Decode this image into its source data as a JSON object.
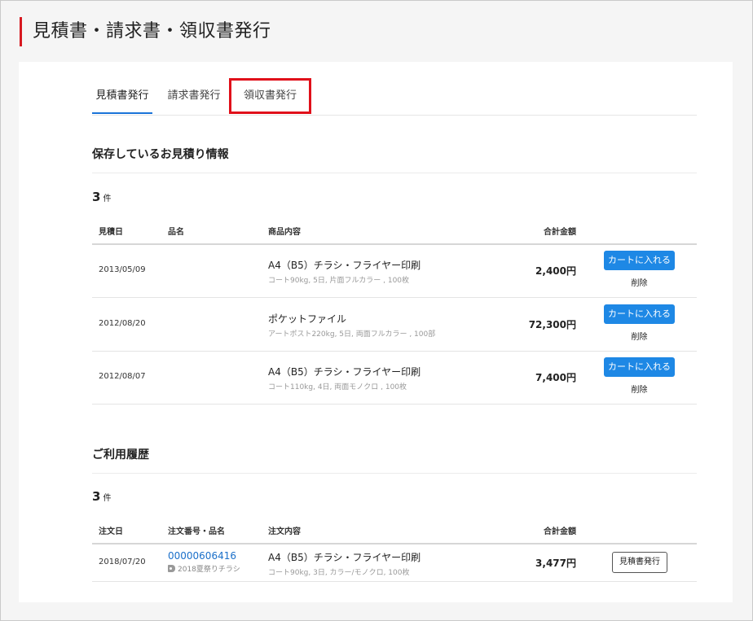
{
  "page": {
    "title": "見積書・請求書・領収書発行"
  },
  "tabs": [
    {
      "label": "見積書発行"
    },
    {
      "label": "請求書発行"
    },
    {
      "label": "領収書発行"
    }
  ],
  "quotes": {
    "heading": "保存しているお見積り情報",
    "count": "3",
    "count_unit": "件",
    "headers": {
      "date": "見積日",
      "name": "品名",
      "content": "商品内容",
      "total": "合計金額"
    },
    "cart_label": "カートに入れる",
    "delete_label": "削除",
    "rows": [
      {
        "date": "2013/05/09",
        "name": "",
        "product": "A4（B5）チラシ・フライヤー印刷",
        "detail": "コート90kg, 5日, 片面フルカラー , 100枚",
        "total": "2,400円"
      },
      {
        "date": "2012/08/20",
        "name": "",
        "product": "ポケットファイル",
        "detail": "アートポスト220kg, 5日, 両面フルカラー , 100部",
        "total": "72,300円"
      },
      {
        "date": "2012/08/07",
        "name": "",
        "product": "A4（B5）チラシ・フライヤー印刷",
        "detail": "コート110kg, 4日, 両面モノクロ , 100枚",
        "total": "7,400円"
      }
    ]
  },
  "history": {
    "heading": "ご利用履歴",
    "count": "3",
    "count_unit": "件",
    "headers": {
      "date": "注文日",
      "order": "注文番号・品名",
      "content": "注文内容",
      "total": "合計金額"
    },
    "issue_label": "見積書発行",
    "rows": [
      {
        "date": "2018/07/20",
        "order_no": "00000606416",
        "tag": "2018夏祭りチラシ",
        "product": "A4（B5）チラシ・フライヤー印刷",
        "detail": "コート90kg, 3日, カラー/モノクロ, 100枚",
        "total": "3,477円"
      }
    ]
  },
  "colors": {
    "accent_red": "#d71920",
    "highlight_red": "#e0101a",
    "button_blue": "#1e88e5",
    "link_blue": "#1a6fc9"
  }
}
